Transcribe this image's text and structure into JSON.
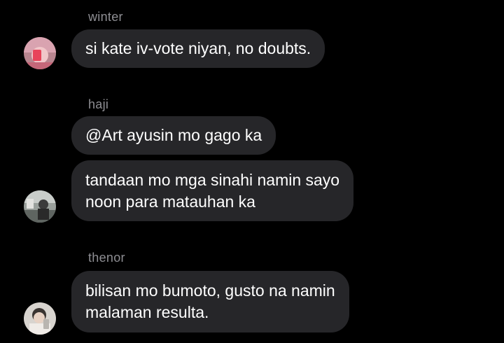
{
  "thread": {
    "groups": [
      {
        "sender": "winter",
        "messages": [
          {
            "lines": [
              "si kate iv-vote niyan, no doubts."
            ]
          }
        ]
      },
      {
        "sender": "haji",
        "messages": [
          {
            "lines": [
              "@Art ayusin mo gago ka"
            ]
          },
          {
            "lines": [
              "tandaan mo mga sinahi namin sayo",
              "noon para matauhan ka"
            ]
          }
        ]
      },
      {
        "sender": "thenor",
        "messages": [
          {
            "lines": [
              "bilisan mo bumoto, gusto na namin",
              "malaman resulta."
            ]
          }
        ]
      }
    ]
  },
  "colors": {
    "background": "#000000",
    "bubble": "#262629",
    "message_text": "#ffffff",
    "sender_text": "#8e8e93"
  },
  "icons": {
    "avatar_winter": "user-photo-avatar",
    "avatar_haji": "user-photo-avatar",
    "avatar_thenor": "user-photo-avatar"
  }
}
